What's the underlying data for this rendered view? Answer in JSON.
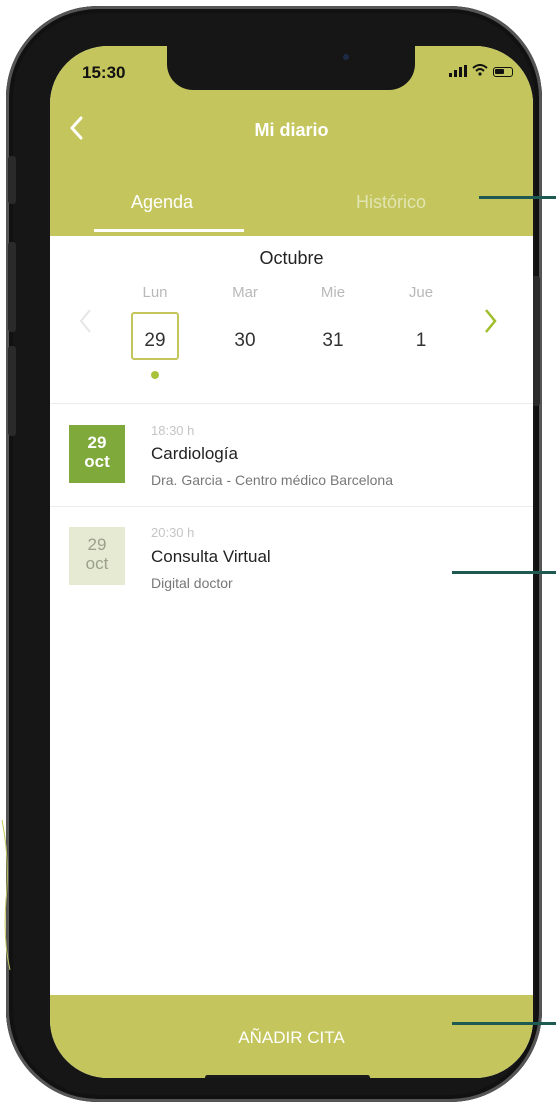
{
  "status_bar": {
    "time": "15:30"
  },
  "header": {
    "title": "Mi diario"
  },
  "tabs": [
    {
      "label": "Agenda",
      "active": true
    },
    {
      "label": "Histórico",
      "active": false
    }
  ],
  "calendar": {
    "month": "Octubre",
    "days": [
      {
        "name": "Lun",
        "number": "29",
        "selected": true,
        "has_event": true
      },
      {
        "name": "Mar",
        "number": "30"
      },
      {
        "name": "Mie",
        "number": "31"
      },
      {
        "name": "Jue",
        "number": "1"
      }
    ],
    "prev_icon": "chevron-left-icon",
    "next_icon": "chevron-right-icon"
  },
  "appointments": [
    {
      "day": "29",
      "month": "oct",
      "time": "18:30 h",
      "title": "Cardiología",
      "subtitle": "Dra. Garcia - Centro médico Barcelona",
      "active": true
    },
    {
      "day": "29",
      "month": "oct",
      "time": "20:30 h",
      "title": "Consulta Virtual",
      "subtitle": "Digital doctor",
      "active": false
    }
  ],
  "footer": {
    "add_label": "AÑADIR CITA"
  },
  "colors": {
    "brand": "#c4c65d",
    "accent_green": "#7fa93a",
    "inactive_date": "#e6ead3",
    "callout": "#1e5a52"
  }
}
